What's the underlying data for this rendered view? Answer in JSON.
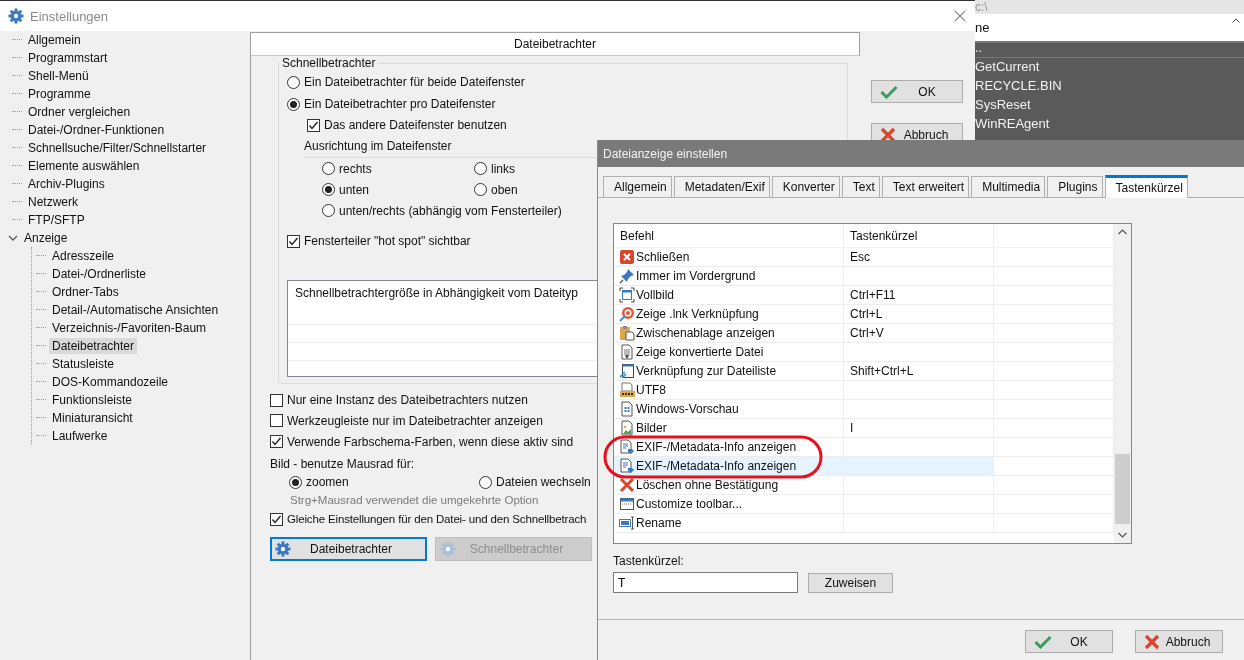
{
  "background_window": {
    "path": "c:\\",
    "column_1": "ne",
    "rows": [
      "..",
      "GetCurrent",
      "RECYCLE.BIN",
      "SysReset",
      "WinREAgent"
    ]
  },
  "settings": {
    "title": "Einstellungen",
    "tree": [
      {
        "label": "Allgemein",
        "selected": false
      },
      {
        "label": "Programmstart",
        "selected": false
      },
      {
        "label": "Shell-Menü",
        "selected": false
      },
      {
        "label": "Programme",
        "selected": false
      },
      {
        "label": "Ordner vergleichen",
        "selected": false
      },
      {
        "label": "Datei-/Ordner-Funktionen",
        "selected": false
      },
      {
        "label": "Schnellsuche/Filter/Schnellstarter",
        "selected": false
      },
      {
        "label": "Elemente auswählen",
        "selected": false
      },
      {
        "label": "Archiv-Plugins",
        "selected": false
      },
      {
        "label": "Netzwerk",
        "selected": false
      },
      {
        "label": "FTP/SFTP",
        "selected": false
      },
      {
        "label": "Anzeige",
        "selected": false,
        "expanded": true,
        "children": [
          {
            "label": "Adresszeile",
            "selected": false
          },
          {
            "label": "Datei-/Ordnerliste",
            "selected": false
          },
          {
            "label": "Ordner-Tabs",
            "selected": false
          },
          {
            "label": "Detail-/Automatische Ansichten",
            "selected": false
          },
          {
            "label": "Verzeichnis-/Favoriten-Baum",
            "selected": false
          },
          {
            "label": "Dateibetrachter",
            "selected": true
          },
          {
            "label": "Statusleiste",
            "selected": false
          },
          {
            "label": "DOS-Kommandozeile",
            "selected": false
          },
          {
            "label": "Funktionsleiste",
            "selected": false
          },
          {
            "label": "Miniaturansicht",
            "selected": false
          },
          {
            "label": "Laufwerke",
            "selected": false
          }
        ]
      }
    ],
    "panel": {
      "header": "Dateibetrachter",
      "group": {
        "title": "Schnellbetrachter",
        "options": [
          {
            "kind": "radio",
            "label": "Ein Dateibetrachter für beide Dateifenster",
            "selected": false
          },
          {
            "kind": "radio",
            "label": "Ein Dateibetrachter pro Dateifenster",
            "selected": true
          },
          {
            "kind": "checkbox",
            "label": "Das andere Dateifenster benutzen",
            "checked": true
          }
        ],
        "alignment": {
          "title": "Ausrichtung im Dateifenster",
          "options": [
            {
              "label": "rechts",
              "selected": false
            },
            {
              "label": "links",
              "selected": false
            },
            {
              "label": "unten",
              "selected": true
            },
            {
              "label": "oben",
              "selected": false
            },
            {
              "label": "unten/rechts (abhängig vom Fensterteiler)",
              "selected": false
            }
          ]
        },
        "hotspot": {
          "label": "Fensterteiler \"hot spot\" sichtbar",
          "checked": true
        },
        "size_table": {
          "title": "Schnellbetrachtergröße in Abhängigkeit vom Dateityp"
        }
      },
      "checkboxes": [
        {
          "label": "Nur eine Instanz des Dateibetrachters nutzen",
          "checked": false
        },
        {
          "label": "Werkzeugleiste nur im Dateibetrachter anzeigen",
          "checked": false
        },
        {
          "label": "Verwende Farbschema-Farben, wenn diese aktiv sind",
          "checked": true
        }
      ],
      "wheel": {
        "label": "Bild - benutze Mausrad für:",
        "options": [
          {
            "label": "zoomen",
            "selected": true
          },
          {
            "label": "Dateien wechseln",
            "selected": false
          }
        ],
        "hint": "Strg+Mausrad verwendet die umgekehrte Option"
      },
      "same_settings": {
        "label": "Gleiche Einstellungen für den Datei- und den Schnellbetrach",
        "checked": true
      },
      "buttons": [
        {
          "label": "Dateibetrachter",
          "disabled": false,
          "focused": true
        },
        {
          "label": "Schnellbetrachter",
          "disabled": true,
          "focused": false
        }
      ]
    },
    "buttons": [
      {
        "kind": "ok",
        "label": "OK"
      },
      {
        "kind": "cancel",
        "label": "Abbruch"
      }
    ]
  },
  "dialog": {
    "title": "Dateianzeige einstellen",
    "tabs": [
      {
        "label": "Allgemein",
        "selected": false
      },
      {
        "label": "Metadaten/Exif",
        "selected": false
      },
      {
        "label": "Konverter",
        "selected": false
      },
      {
        "label": "Text",
        "selected": false
      },
      {
        "label": "Text erweitert",
        "selected": false
      },
      {
        "label": "Multimedia",
        "selected": false
      },
      {
        "label": "Plugins",
        "selected": false
      },
      {
        "label": "Tastenkürzel",
        "selected": true
      }
    ],
    "table": {
      "columns": [
        "Befehl",
        "Tastenkürzel"
      ],
      "rows": [
        {
          "kind": "close",
          "command": "Schließen",
          "shortcut": "Esc",
          "selected": false
        },
        {
          "kind": "pin",
          "command": "Immer im Vordergrund",
          "selected": false
        },
        {
          "kind": "fullscreen",
          "command": "Vollbild",
          "shortcut": "Ctrl+F11",
          "selected": false
        },
        {
          "kind": "target",
          "command": "Zeige .lnk Verknüpfung",
          "shortcut": "Ctrl+L",
          "selected": false
        },
        {
          "kind": "clipboard",
          "command": "Zwischenablage anzeigen",
          "shortcut": "Ctrl+V",
          "selected": false
        },
        {
          "kind": "convert",
          "command": "Zeige konvertierte Datei",
          "selected": false
        },
        {
          "kind": "link",
          "command": "Verknüpfung zur Dateiliste",
          "shortcut": "Shift+Ctrl+L",
          "selected": false
        },
        {
          "kind": "utf8",
          "command": "UTF8",
          "selected": false
        },
        {
          "kind": "preview",
          "command": "Windows-Vorschau",
          "selected": false
        },
        {
          "kind": "image",
          "command": "Bilder",
          "shortcut": "I",
          "selected": false
        },
        {
          "kind": "metadata",
          "command": "EXIF-/Metadata-Info anzeigen",
          "selected": false
        },
        {
          "kind": "metadata",
          "command": "EXIF-/Metadata-Info anzeigen",
          "selected": true
        },
        {
          "kind": "delete",
          "command": "Löschen ohne Bestätigung",
          "selected": false
        },
        {
          "kind": "toolbar",
          "command": "Customize toolbar...",
          "selected": false
        },
        {
          "kind": "rename",
          "command": "Rename",
          "selected": false
        }
      ]
    },
    "shortcut_label": "Tastenkürzel:",
    "shortcut_value": "T",
    "assign_button": "Zuweisen",
    "buttons": [
      {
        "kind": "ok",
        "label": "OK"
      },
      {
        "kind": "cancel",
        "label": "Abbruch"
      }
    ]
  },
  "annotation": {
    "kind": "ellipse"
  }
}
